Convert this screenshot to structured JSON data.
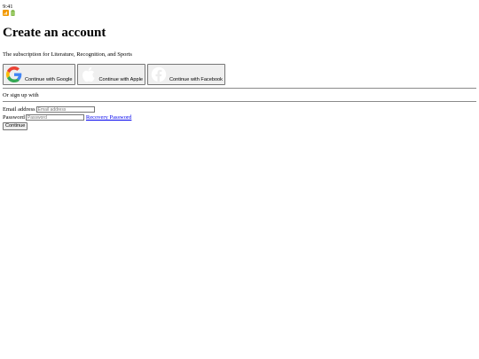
{
  "status_bar": {
    "time": "9:41",
    "icons": [
      "wifi-icon",
      "battery-icon"
    ]
  },
  "header": {
    "title": "Create an account",
    "subtitle": "The subscription for Literature, Recognition, and Sports"
  },
  "social_buttons": [
    {
      "label": "Continue with Google",
      "icon": "google-icon"
    },
    {
      "label": "Continue with Apple",
      "icon": "apple-icon"
    },
    {
      "label": "Continue with Facebook",
      "icon": "facebook-icon"
    }
  ],
  "divider_text": "Or sign up with",
  "form": {
    "email_label": "Email address",
    "email_placeholder": "Email address",
    "email_value": "",
    "password_label": "Password",
    "password_placeholder": "Password",
    "password_value": "",
    "recover_link": "Recovery Password",
    "submit_label": "Continue"
  },
  "colors": {
    "google_blue": "#4285F4",
    "google_red": "#EA4335",
    "google_yellow": "#FBBC05",
    "google_green": "#34A853",
    "link": "#0000EE",
    "wifi": "#F29900",
    "battery": "#7CB342"
  }
}
